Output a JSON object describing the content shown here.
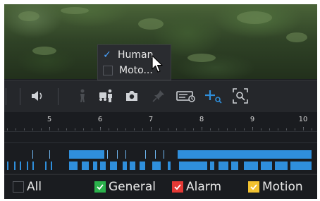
{
  "smart_menu": {
    "items": [
      {
        "label": "Human",
        "checked": true
      },
      {
        "label": "Moto...",
        "checked": false
      }
    ]
  },
  "toolbar": {
    "icons": [
      "speaker-icon",
      "human-filter-icon",
      "person-vehicle-icon",
      "snapshot-icon",
      "pin-icon",
      "event-list-icon",
      "smart-search-icon",
      "zoom-icon"
    ],
    "accent_color": "#2f8fdc"
  },
  "timeline": {
    "ticks": [
      "5",
      "6",
      "7",
      "8",
      "9",
      "10"
    ]
  },
  "legend": {
    "items": [
      {
        "label": "All",
        "color": "",
        "checked": false
      },
      {
        "label": "General",
        "color": "#2bb24c",
        "checked": true
      },
      {
        "label": "Alarm",
        "color": "#e53935",
        "checked": true
      },
      {
        "label": "Motion",
        "color": "#f2c230",
        "checked": true
      }
    ]
  }
}
